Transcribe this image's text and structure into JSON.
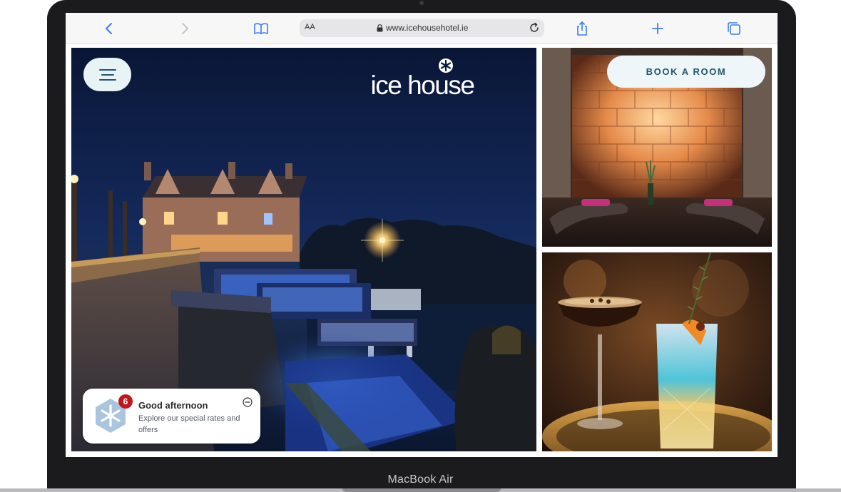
{
  "device": {
    "label": "MacBook Air"
  },
  "browser": {
    "text_size_label": "AA",
    "url": "www.icehousehotel.ie",
    "icons": {
      "back": "chevron-left-icon",
      "forward": "chevron-right-icon",
      "bookmarks": "book-icon",
      "lock": "lock-icon",
      "reload": "reload-icon",
      "share": "share-icon",
      "new_tab": "plus-icon",
      "tabs": "tabs-icon"
    },
    "accent_color": "#3b7cf6"
  },
  "site": {
    "logo_text": "ice house",
    "menu_icon": "hamburger-menu-icon",
    "book_button": "BOOK A ROOM",
    "brand_color": "#24566c",
    "notification": {
      "badge_count": "6",
      "title": "Good afternoon",
      "subtitle": "Explore our special rates and offers",
      "icon": "snowflake-icon",
      "close_icon": "minus-circle-icon"
    },
    "images": {
      "hero": "hotel exterior at night by the river",
      "side_top": "salt wall spa relaxation room",
      "side_bottom": "cocktails on a bar tray"
    }
  }
}
